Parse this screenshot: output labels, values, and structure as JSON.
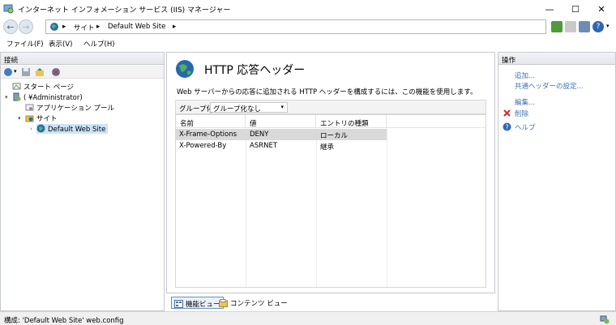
{
  "window": {
    "title": "インターネット インフォメーション サービス (IIS) マネージャー",
    "minimize_glyph": "—",
    "maximize_glyph": "☐",
    "close_glyph": "✕"
  },
  "address_bar": {
    "breadcrumbs": [
      "サイト",
      "Default Web Site"
    ],
    "separator": "▸"
  },
  "menu": {
    "items": [
      "ファイル(F)",
      "表示(V)",
      "ヘルプ(H)"
    ]
  },
  "connections": {
    "header": "接続",
    "tree": {
      "start_page": "スタート ページ",
      "server": "(            ¥Administrator)",
      "app_pools": "アプリケーション プール",
      "sites": "サイト",
      "default_site": "Default Web Site"
    }
  },
  "feature": {
    "title": "HTTP 応答ヘッダー",
    "description": "Web サーバーからの応答に追加される HTTP ヘッダーを構成するには、この機能を使用します。",
    "group_by_label": "グループ化:",
    "group_by_value": "グループ化なし",
    "columns": [
      "名前",
      "値",
      "エントリの種類"
    ],
    "rows": [
      {
        "name": "X-Frame-Options",
        "value": "DENY",
        "entry_type": "ローカル"
      },
      {
        "name": "X-Powered-By",
        "value": "ASRNET",
        "entry_type": "継承"
      }
    ]
  },
  "view_tabs": {
    "features_view": "機能ビュー",
    "content_view": "コンテンツ ビュー"
  },
  "actions": {
    "header": "操作",
    "add": "追加...",
    "set_common_headers": "共通ヘッダーの設定...",
    "edit": "編集...",
    "remove": "削除",
    "help": "ヘルプ"
  },
  "status": {
    "text": "構成: 'Default Web Site' web.config"
  },
  "colors": {
    "link": "#3f72ad",
    "selected_row": "#d9d9d9",
    "remove_icon": "#d0312d"
  }
}
